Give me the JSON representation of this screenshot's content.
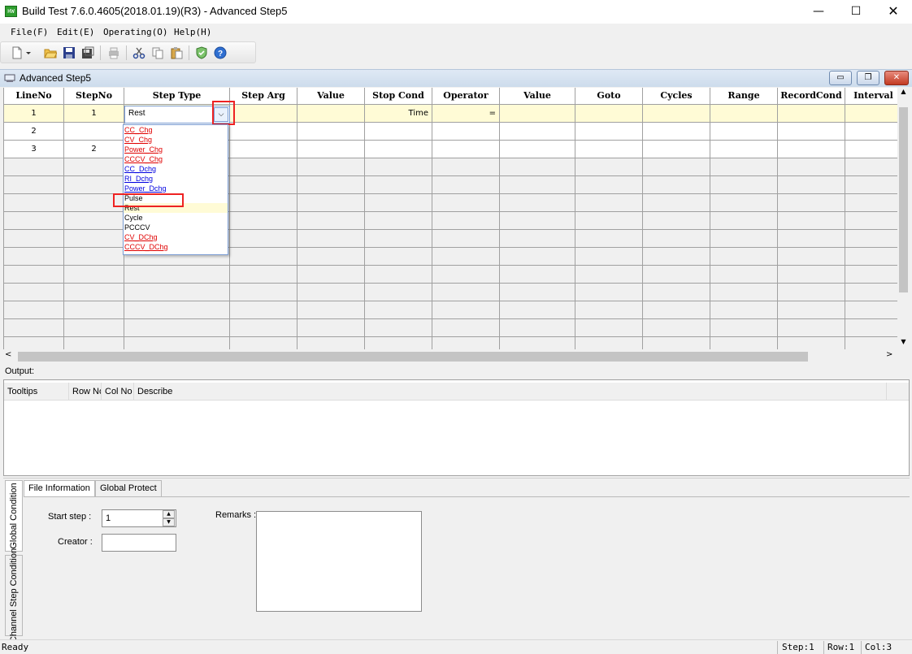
{
  "window": {
    "title": "Build Test  7.6.0.4605(2018.01.19)(R3) - Advanced Step5",
    "app_icon_text": "HW",
    "min_glyph": "—",
    "max_glyph": "☐",
    "close_glyph": "✕"
  },
  "menu": [
    {
      "label": "File(F)"
    },
    {
      "label": "Edit(E)"
    },
    {
      "label": "Operating(O)"
    },
    {
      "label": "Help(H)"
    }
  ],
  "toolbar": {
    "icons": [
      "new-file-icon",
      "dropdown-arrow-icon",
      "open-folder-icon",
      "save-icon",
      "save-as-icon",
      "print-icon",
      "cut-icon",
      "copy-icon",
      "paste-icon",
      "check-shield-icon",
      "help-icon"
    ]
  },
  "document": {
    "title": "Advanced Step5",
    "min_glyph": "▭",
    "restore_glyph": "❐",
    "close_glyph": "✕"
  },
  "grid": {
    "columns": [
      "LineNo",
      "StepNo",
      "Step Type",
      "Step Arg",
      "Value",
      "Stop Cond",
      "Operator",
      "Value",
      "Goto",
      "Cycles",
      "Range",
      "RecordCond",
      "Interval"
    ],
    "rows": [
      [
        "1",
        "1",
        "",
        "",
        "",
        "Time",
        "=",
        "",
        "",
        "",
        "",
        "",
        ""
      ],
      [
        "2",
        "",
        "",
        "",
        "",
        "",
        "",
        "",
        "",
        "",
        "",
        "",
        ""
      ],
      [
        "3",
        "2",
        "",
        "",
        "",
        "",
        "",
        "",
        "",
        "",
        "",
        "",
        ""
      ]
    ],
    "empty_rows": 11,
    "selected_row": 0
  },
  "step_combo": {
    "value": "Rest",
    "arrow_glyph": "⌵"
  },
  "dropdown": {
    "items": [
      {
        "label": "CC_Chg",
        "color": "#e00000"
      },
      {
        "label": "CV_Chg",
        "color": "#e00000"
      },
      {
        "label": "Power_Chg",
        "color": "#e00000"
      },
      {
        "label": "CCCV_Chg",
        "color": "#e00000"
      },
      {
        "label": "CC_Dchg",
        "color": "#0000e0"
      },
      {
        "label": "RI_Dchg",
        "color": "#0000e0"
      },
      {
        "label": "Power_Dchg",
        "color": "#0000e0"
      },
      {
        "label": "Pulse",
        "color": "#000000"
      },
      {
        "label": "Rest",
        "color": "#000000"
      },
      {
        "label": "Cycle",
        "color": "#000000"
      },
      {
        "label": "PCCCV",
        "color": "#000000"
      },
      {
        "label": "CV_DChg",
        "color": "#e00000"
      },
      {
        "label": "CCCV_DChg",
        "color": "#e00000"
      }
    ],
    "hover_index": 8
  },
  "output": {
    "label": "Output:",
    "columns": [
      "Tooltips",
      "Row No",
      "Col No",
      "Describe"
    ]
  },
  "bottom": {
    "vtabs": [
      "Global Condition",
      "Channel Step Condition"
    ],
    "htabs": [
      "File Information",
      "Global Protect"
    ],
    "start_step_label": "Start step :",
    "start_step_value": "1",
    "creator_label": "Creator :",
    "remarks_label": "Remarks :"
  },
  "status": {
    "ready": "Ready",
    "step": "Step:1",
    "row": "Row:1",
    "col": "Col:3"
  },
  "colors": {
    "accent_red": "#e22222",
    "selected_row": "#fffbd6"
  }
}
